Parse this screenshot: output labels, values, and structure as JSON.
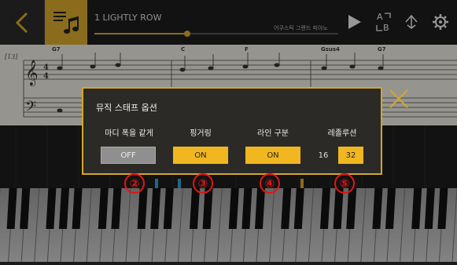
{
  "topbar": {
    "song_title": "1 LIGHTLY ROW",
    "instrument": "어쿠스틱 그랜드 피아노",
    "progress_percent": 38,
    "colors": {
      "accent": "#d4a72c",
      "bar_bg": "#1d1d1d"
    },
    "icons": [
      "back-chevron-icon",
      "music-note-icon",
      "play-icon",
      "ab-repeat-icon",
      "loop-icon",
      "settings-gear-icon"
    ]
  },
  "score": {
    "measure_number": "[13]",
    "chords": [
      "G7",
      "C",
      "F",
      "Gsus4",
      "G7"
    ],
    "time_signature_top": "4",
    "time_signature_bottom": "4"
  },
  "dialog": {
    "title": "뮤직 스태프 옵션",
    "options": [
      {
        "label": "마디 폭을 같게",
        "value": "OFF"
      },
      {
        "label": "핑거링",
        "value": "ON"
      },
      {
        "label": "라인 구분",
        "value": "ON"
      },
      {
        "label": "레졸루션",
        "values": [
          "16",
          "32"
        ],
        "selected": "32"
      }
    ]
  },
  "annotations": [
    "②",
    "③",
    "④",
    "⑤"
  ]
}
